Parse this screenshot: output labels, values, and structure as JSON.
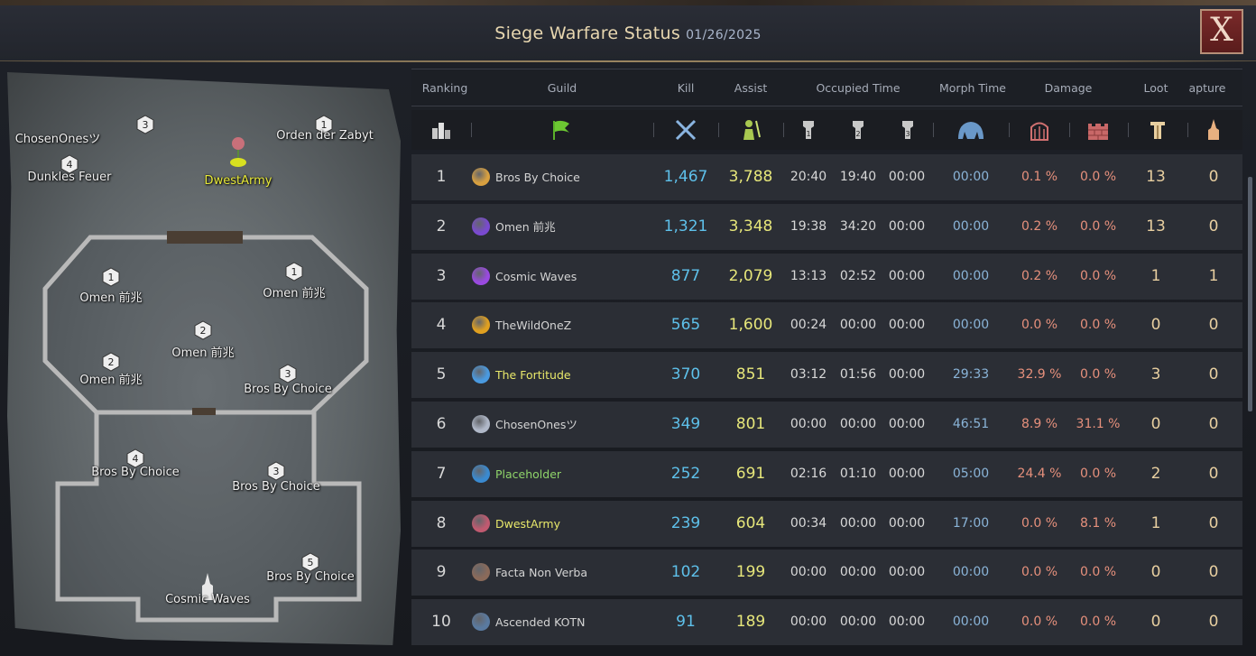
{
  "window": {
    "title": "Siege Warfare Status",
    "date": "01/26/2025",
    "close_label": "X"
  },
  "map": {
    "labels": [
      {
        "text": "ChosenOnesツ",
        "marker": "3",
        "highlight": false
      },
      {
        "text": "Orden der Zabyt",
        "marker": "1",
        "highlight": false
      },
      {
        "text": "Dunkles Feuer",
        "marker": "4",
        "highlight": false
      },
      {
        "text": "DwestArmy",
        "marker": "rose",
        "highlight": true
      },
      {
        "text": "Omen 前兆",
        "marker": "1",
        "highlight": false
      },
      {
        "text": "Omen 前兆",
        "marker": "1",
        "highlight": false
      },
      {
        "text": "Omen 前兆",
        "marker": "2",
        "highlight": false
      },
      {
        "text": "Omen 前兆",
        "marker": "2",
        "highlight": false
      },
      {
        "text": "Bros By Choice",
        "marker": "3",
        "highlight": false
      },
      {
        "text": "Bros By Choice",
        "marker": "4",
        "highlight": false
      },
      {
        "text": "Bros By Choice",
        "marker": "3",
        "highlight": false
      },
      {
        "text": "Bros By Choice",
        "marker": "5",
        "highlight": false
      },
      {
        "text": "Cosmic Waves",
        "marker": "spire",
        "highlight": false
      }
    ]
  },
  "table": {
    "headers": [
      "Ranking",
      "Guild",
      "Kill",
      "Assist",
      "Occupied Time",
      "Morph Time",
      "Damage",
      "Loot",
      "apture"
    ],
    "icons": [
      "ranking-podium-icon",
      "guild-flag-icon",
      "crossed-swords-icon",
      "assist-soldier-icon",
      "fort-1-icon",
      "fort-2-icon",
      "fort-3-icon",
      "morph-beast-icon",
      "gate-icon",
      "wall-icon",
      "loot-icon",
      "capture-spire-icon"
    ],
    "rows": [
      {
        "rank": "1",
        "guild": "Bros By Choice",
        "color": "normal",
        "kill": "1,467",
        "assist": "3,788",
        "t1": "20:40",
        "t2": "19:40",
        "t3": "00:00",
        "morph": "00:00",
        "dmg_gate": "0.1 %",
        "dmg_wall": "0.0 %",
        "loot": "13",
        "capture": "0",
        "emblem": "#d8a040"
      },
      {
        "rank": "2",
        "guild": "Omen 前兆",
        "color": "normal",
        "kill": "1,321",
        "assist": "3,348",
        "t1": "19:38",
        "t2": "34:20",
        "t3": "00:00",
        "morph": "00:00",
        "dmg_gate": "0.2 %",
        "dmg_wall": "0.0 %",
        "loot": "13",
        "capture": "0",
        "emblem": "#7a4ad0"
      },
      {
        "rank": "3",
        "guild": "Cosmic Waves",
        "color": "normal",
        "kill": "877",
        "assist": "2,079",
        "t1": "13:13",
        "t2": "02:52",
        "t3": "00:00",
        "morph": "00:00",
        "dmg_gate": "0.2 %",
        "dmg_wall": "0.0 %",
        "loot": "1",
        "capture": "1",
        "emblem": "#9a4ae0"
      },
      {
        "rank": "4",
        "guild": "TheWildOneZ",
        "color": "normal",
        "kill": "565",
        "assist": "1,600",
        "t1": "00:24",
        "t2": "00:00",
        "t3": "00:00",
        "morph": "00:00",
        "dmg_gate": "0.0 %",
        "dmg_wall": "0.0 %",
        "loot": "0",
        "capture": "0",
        "emblem": "#e0a020"
      },
      {
        "rank": "5",
        "guild": "The Fortitude",
        "color": "yellow",
        "kill": "370",
        "assist": "851",
        "t1": "03:12",
        "t2": "01:56",
        "t3": "00:00",
        "morph": "29:33",
        "dmg_gate": "32.9 %",
        "dmg_wall": "0.0 %",
        "loot": "3",
        "capture": "0",
        "emblem": "#4a9ae0"
      },
      {
        "rank": "6",
        "guild": "ChosenOnesツ",
        "color": "normal",
        "kill": "349",
        "assist": "801",
        "t1": "00:00",
        "t2": "00:00",
        "t3": "00:00",
        "morph": "46:51",
        "dmg_gate": "8.9 %",
        "dmg_wall": "31.1 %",
        "loot": "0",
        "capture": "0",
        "emblem": "#b0b8c8"
      },
      {
        "rank": "7",
        "guild": "Placeholder",
        "color": "green",
        "kill": "252",
        "assist": "691",
        "t1": "02:16",
        "t2": "01:10",
        "t3": "00:00",
        "morph": "05:00",
        "dmg_gate": "24.4 %",
        "dmg_wall": "0.0 %",
        "loot": "2",
        "capture": "0",
        "emblem": "#3a8ad0"
      },
      {
        "rank": "8",
        "guild": "DwestArmy",
        "color": "yellow",
        "kill": "239",
        "assist": "604",
        "t1": "00:34",
        "t2": "00:00",
        "t3": "00:00",
        "morph": "17:00",
        "dmg_gate": "0.0 %",
        "dmg_wall": "8.1 %",
        "loot": "1",
        "capture": "0",
        "emblem": "#c05a70"
      },
      {
        "rank": "9",
        "guild": "Facta Non Verba",
        "color": "normal",
        "kill": "102",
        "assist": "199",
        "t1": "00:00",
        "t2": "00:00",
        "t3": "00:00",
        "morph": "00:00",
        "dmg_gate": "0.0 %",
        "dmg_wall": "0.0 %",
        "loot": "0",
        "capture": "0",
        "emblem": "#8a6a5a"
      },
      {
        "rank": "10",
        "guild": "Ascended KOTN",
        "color": "normal",
        "kill": "91",
        "assist": "189",
        "t1": "00:00",
        "t2": "00:00",
        "t3": "00:00",
        "morph": "00:00",
        "dmg_gate": "0.0 %",
        "dmg_wall": "0.0 %",
        "loot": "0",
        "capture": "0",
        "emblem": "#5a7aa0"
      }
    ]
  }
}
